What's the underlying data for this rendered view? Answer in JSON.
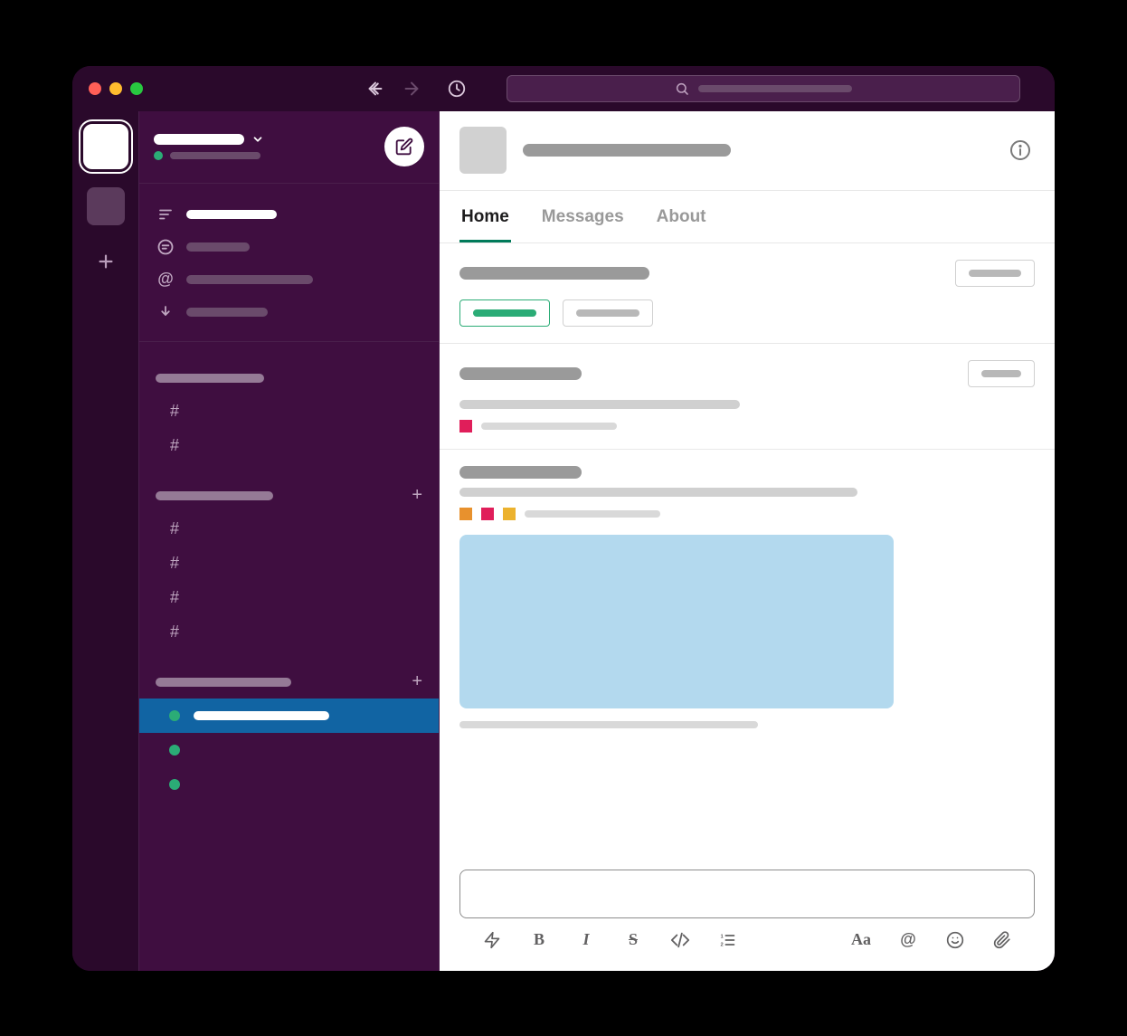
{
  "tabs": {
    "home": "Home",
    "messages": "Messages",
    "about": "About"
  },
  "icons": {
    "back": "back-icon",
    "forward": "forward-icon",
    "history": "history-icon",
    "search": "search-icon",
    "compose": "compose-icon",
    "info": "info-icon",
    "sort": "sort-icon",
    "thread": "thread-icon",
    "mention": "mention-icon",
    "download": "download-icon"
  },
  "colors": {
    "accent": "#007a5a",
    "selected": "#1164A3",
    "sidebar": "#3F0E40",
    "titlebar": "#2a092b",
    "status_red": "#E01E5A",
    "status_orange": "#ECB22E",
    "status_green": "#2bac76",
    "preview_bg": "#b3d9ee"
  },
  "sidebar": {
    "nav_items": [
      "sort",
      "threads",
      "mentions",
      "downloads"
    ],
    "section_a": {
      "items": 2
    },
    "section_b": {
      "items": 4
    },
    "section_c": {
      "selected_index": 0,
      "items": 3
    }
  },
  "content": {
    "block1": {
      "chips": [
        "primary",
        "secondary"
      ]
    },
    "block2": {
      "legend": [
        "#E01E5A"
      ]
    },
    "block3": {
      "legend": [
        "#E8912D",
        "#E01E5A",
        "#ECB22E"
      ]
    }
  }
}
